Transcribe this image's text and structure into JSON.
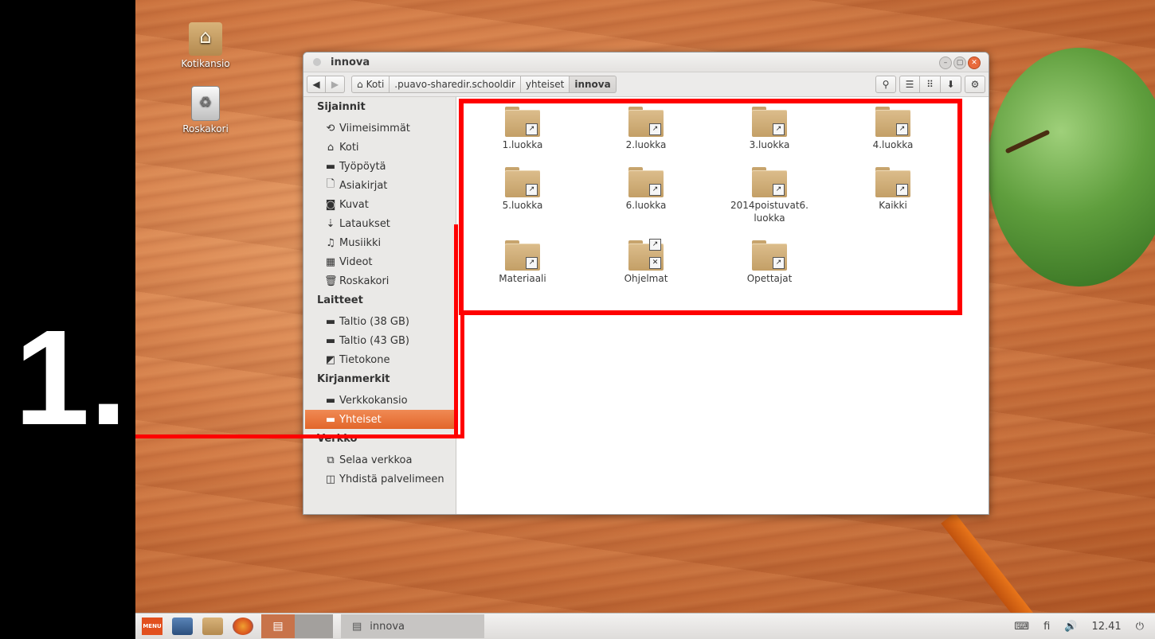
{
  "annotation": {
    "number": "1."
  },
  "desktop": {
    "icons": [
      {
        "label": "Kotikansio",
        "icon": "home-folder-icon"
      },
      {
        "label": "Roskakori",
        "icon": "trash-icon"
      }
    ]
  },
  "window": {
    "title": "innova",
    "controls": {
      "minimize": "–",
      "maximize": "▢",
      "close": "✕"
    },
    "toolbar": {
      "back": "◀",
      "forward": "▶",
      "breadcrumb": [
        ".puavo-sharedir.schooldir",
        "yhteiset",
        "innova"
      ],
      "home": {
        "label": "Koti",
        "icon": "home-icon"
      },
      "search": "⚲",
      "list_view": "☰",
      "grid_view": "⠿",
      "sort": "⬇",
      "settings": "⚙"
    },
    "sidebar": {
      "sections": [
        {
          "header": "Sijainnit",
          "items": [
            {
              "label": "Viimeisimmät",
              "glyph": "⟲"
            },
            {
              "label": "Koti",
              "glyph": "⌂"
            },
            {
              "label": "Työpöytä",
              "glyph": "▬"
            },
            {
              "label": "Asiakirjat",
              "glyph": "🗋"
            },
            {
              "label": "Kuvat",
              "glyph": "◙"
            },
            {
              "label": "Lataukset",
              "glyph": "⇣"
            },
            {
              "label": "Musiikki",
              "glyph": "♫"
            },
            {
              "label": "Videot",
              "glyph": "▦"
            },
            {
              "label": "Roskakori",
              "glyph": "🗑"
            }
          ]
        },
        {
          "header": "Laitteet",
          "items": [
            {
              "label": "Taltio (38 GB)",
              "glyph": "▬"
            },
            {
              "label": "Taltio (43 GB)",
              "glyph": "▬"
            },
            {
              "label": "Tietokone",
              "glyph": "◩"
            }
          ]
        },
        {
          "header": "Kirjanmerkit",
          "items": [
            {
              "label": "Verkkokansio",
              "glyph": "▬"
            },
            {
              "label": "Yhteiset",
              "glyph": "▬",
              "active": true
            }
          ]
        },
        {
          "header": "Verkko",
          "items": [
            {
              "label": "Selaa verkkoa",
              "glyph": "⧉"
            },
            {
              "label": "Yhdistä palvelimeen",
              "glyph": "◫"
            }
          ]
        }
      ]
    },
    "files": [
      {
        "name": "1.luokka",
        "type": "folder-link"
      },
      {
        "name": "2.luokka",
        "type": "folder-link"
      },
      {
        "name": "3.luokka",
        "type": "folder-link"
      },
      {
        "name": "4.luokka",
        "type": "folder-link"
      },
      {
        "name": "5.luokka",
        "type": "folder-link"
      },
      {
        "name": "6.luokka",
        "type": "folder-link"
      },
      {
        "name": "2014poistuvat6.\nluokka",
        "type": "folder-link"
      },
      {
        "name": "Kaikki",
        "type": "folder-link"
      },
      {
        "name": "Materiaali",
        "type": "folder-link"
      },
      {
        "name": "Ohjelmat",
        "type": "folder-link-readonly"
      },
      {
        "name": "Opettajat",
        "type": "folder-link"
      }
    ]
  },
  "taskbar": {
    "menu_label": "MENU",
    "task": {
      "label": "innova"
    },
    "tray": {
      "keyboard": "⌨",
      "lang": "fi",
      "volume": "🔊",
      "time": "12.41",
      "power": "⏻"
    }
  },
  "colors": {
    "annotation_red": "#ff0000",
    "sidebar_active": "#e96f36",
    "accent_orange": "#e2501e"
  }
}
